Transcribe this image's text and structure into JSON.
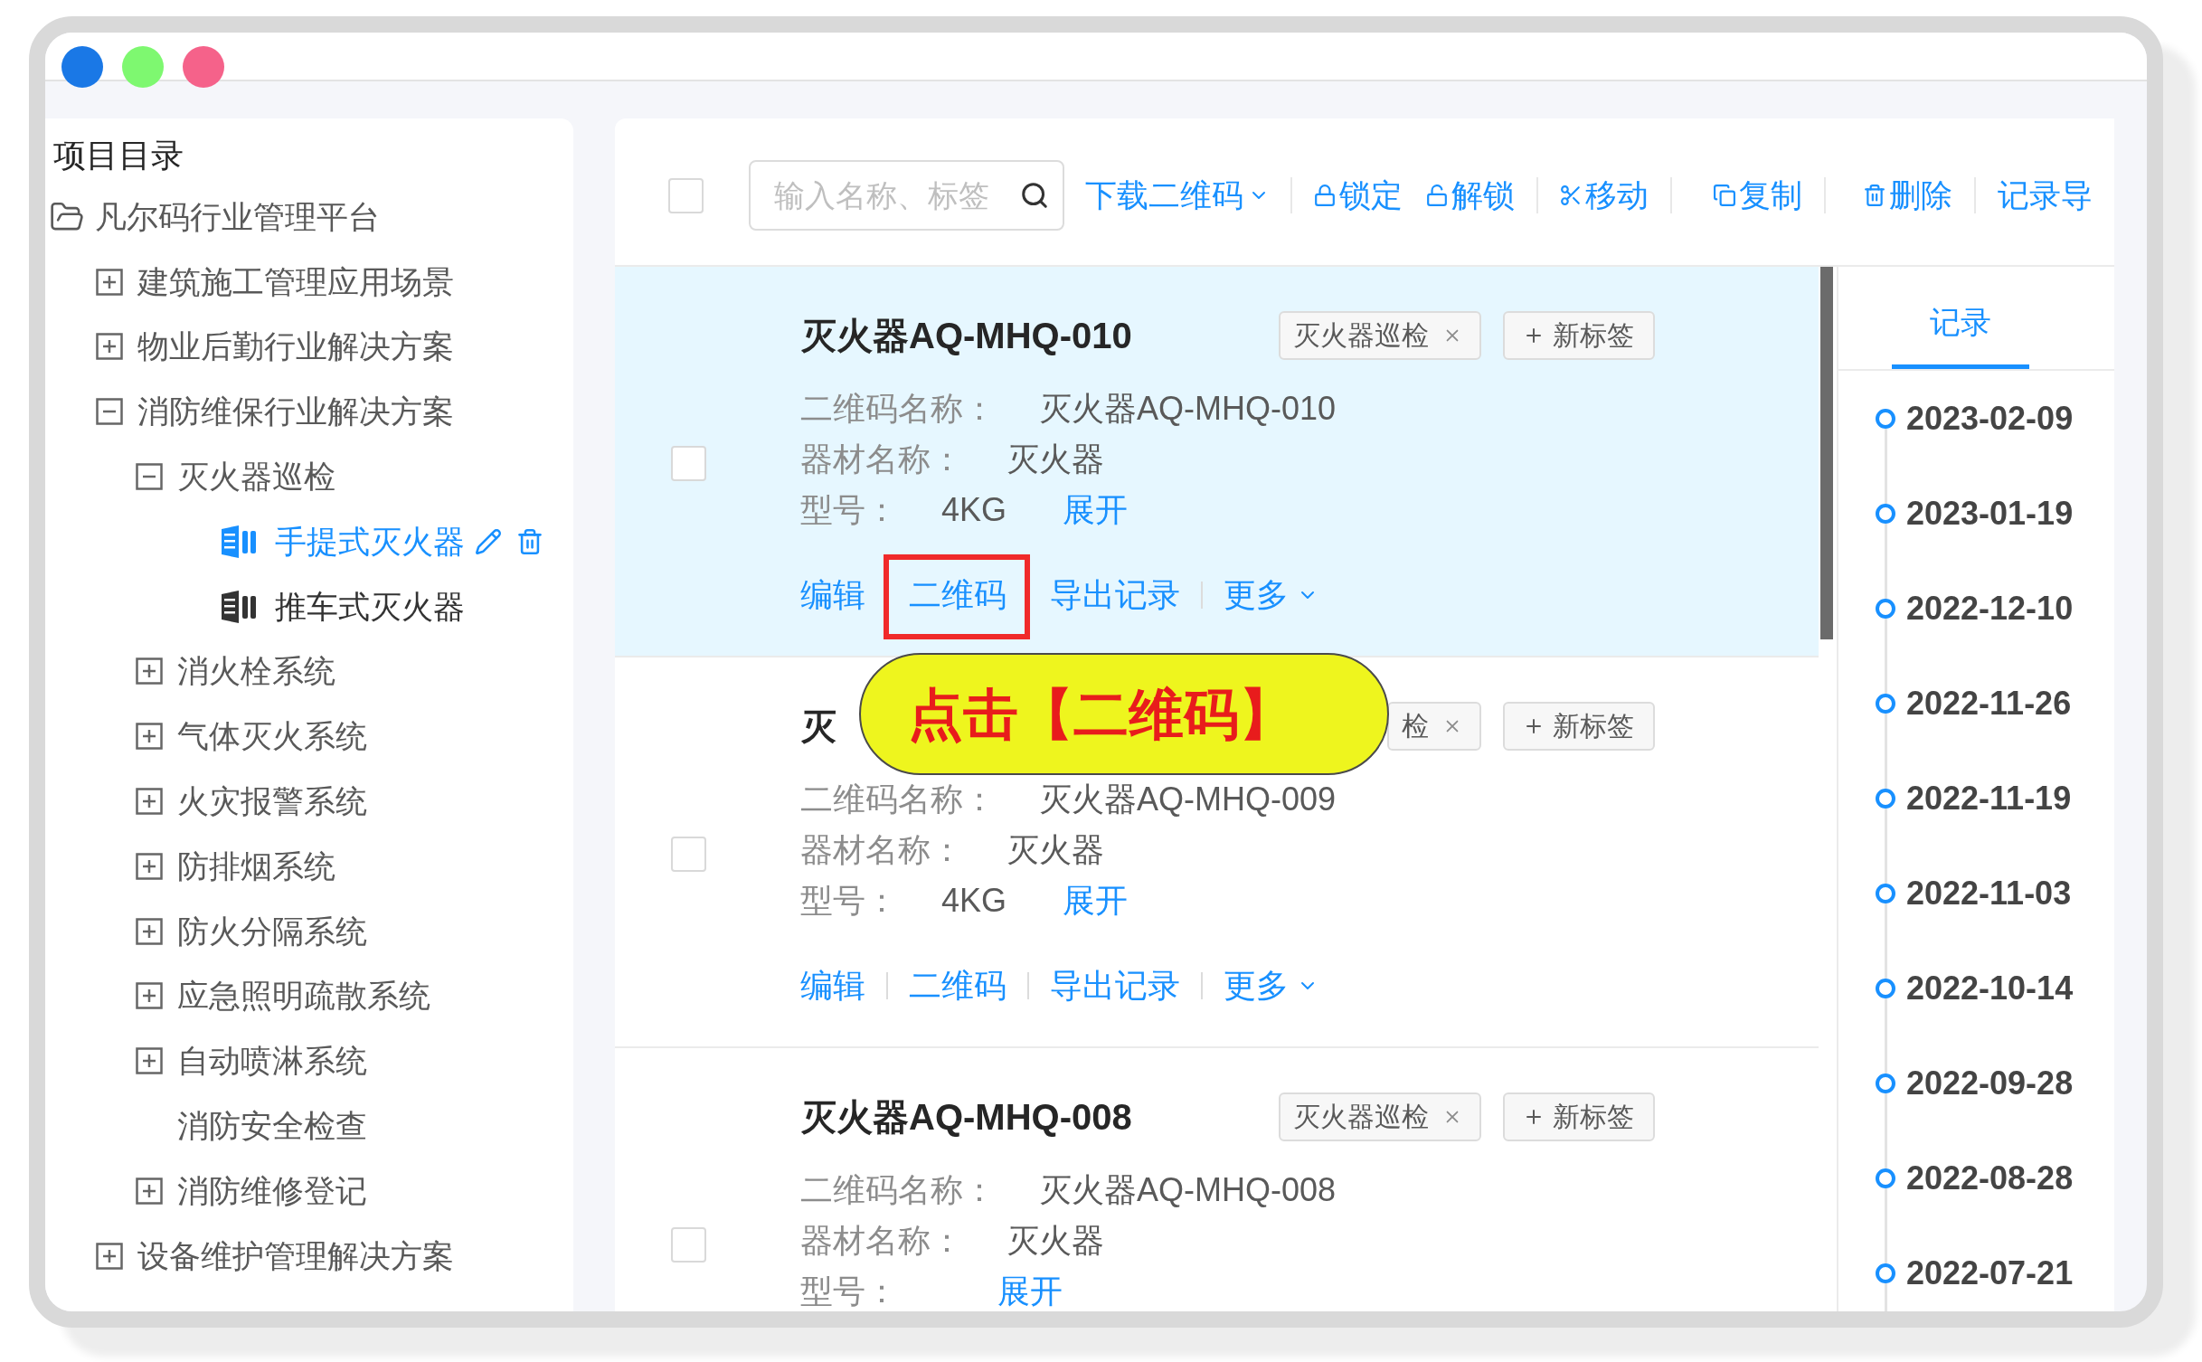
{
  "window": {
    "controls": [
      {
        "color": "#1a78e6"
      },
      {
        "color": "#7ef870"
      },
      {
        "color": "#f5628a"
      }
    ]
  },
  "sidebar": {
    "title": "项目目录",
    "tree": [
      {
        "kind": "root",
        "label": "凡尔码行业管理平台",
        "children": [
          {
            "kind": "group",
            "label": "建筑施工管理应用场景",
            "expanded": false
          },
          {
            "kind": "group",
            "label": "物业后勤行业解决方案",
            "expanded": false
          },
          {
            "kind": "group",
            "label": "消防维保行业解决方案",
            "expanded": true,
            "children": [
              {
                "kind": "group",
                "label": "灭火器巡检",
                "expanded": true,
                "children": [
                  {
                    "kind": "item",
                    "label": "手提式灭火器",
                    "selected": true
                  },
                  {
                    "kind": "item",
                    "label": "推车式灭火器",
                    "selected": false
                  }
                ]
              },
              {
                "kind": "group",
                "label": "消火栓系统",
                "expanded": false
              },
              {
                "kind": "group",
                "label": "气体灭火系统",
                "expanded": false
              },
              {
                "kind": "group",
                "label": "火灾报警系统",
                "expanded": false
              },
              {
                "kind": "group",
                "label": "防排烟系统",
                "expanded": false
              },
              {
                "kind": "group",
                "label": "防火分隔系统",
                "expanded": false
              },
              {
                "kind": "group",
                "label": "应急照明疏散系统",
                "expanded": false
              },
              {
                "kind": "group",
                "label": "自动喷淋系统",
                "expanded": false
              },
              {
                "kind": "leaf",
                "label": "消防安全检查"
              },
              {
                "kind": "group",
                "label": "消防维修登记",
                "expanded": false
              }
            ]
          },
          {
            "kind": "group",
            "label": "设备维护管理解决方案",
            "expanded": false
          }
        ]
      }
    ]
  },
  "toolbar": {
    "select_all": {
      "checked": false
    },
    "search": {
      "placeholder": "输入名称、标签"
    },
    "groups": [
      [
        {
          "kind": "download",
          "label": "下载二维码"
        }
      ],
      [
        {
          "kind": "lock",
          "label": "锁定"
        },
        {
          "kind": "unlock",
          "label": "解锁"
        }
      ],
      [
        {
          "kind": "move",
          "label": "移动"
        }
      ],
      [
        {
          "kind": "copy",
          "label": "复制"
        }
      ],
      [
        {
          "kind": "delete",
          "label": "删除"
        }
      ],
      [
        {
          "kind": "export",
          "label": "记录导"
        }
      ]
    ]
  },
  "cards": [
    {
      "selected": true,
      "checked": false,
      "title": "灭火器AQ-MHQ-010",
      "tags": [
        {
          "kind": "tag",
          "label": "灭火器巡检"
        },
        {
          "kind": "add",
          "label": "新标签"
        }
      ],
      "fields": [
        {
          "label": "二维码名称：",
          "value": "灭火器AQ-MHQ-010"
        },
        {
          "label": "器材名称：",
          "value": "灭火器"
        },
        {
          "label": "型号：",
          "value": "4KG",
          "link": "展开"
        }
      ],
      "actions": [
        {
          "kind": "link",
          "label": "编辑",
          "highlighted": false
        },
        {
          "kind": "link",
          "label": "二维码",
          "highlighted": true
        },
        {
          "kind": "link",
          "label": "导出记录",
          "highlighted": false
        },
        {
          "kind": "menu",
          "label": "更多",
          "highlighted": false
        }
      ]
    },
    {
      "selected": false,
      "checked": false,
      "title": "灭",
      "tags": [
        {
          "kind": "tag",
          "label": "检"
        },
        {
          "kind": "add",
          "label": "新标签"
        }
      ],
      "fields": [
        {
          "label": "二维码名称：",
          "value": "灭火器AQ-MHQ-009"
        },
        {
          "label": "器材名称：",
          "value": "灭火器"
        },
        {
          "label": "型号：",
          "value": "4KG",
          "link": "展开"
        }
      ],
      "actions": [
        {
          "kind": "link",
          "label": "编辑",
          "highlighted": false
        },
        {
          "kind": "link",
          "label": "二维码",
          "highlighted": false
        },
        {
          "kind": "link",
          "label": "导出记录",
          "highlighted": false
        },
        {
          "kind": "menu",
          "label": "更多",
          "highlighted": false
        }
      ]
    },
    {
      "selected": false,
      "checked": false,
      "title": "灭火器AQ-MHQ-008",
      "tags": [
        {
          "kind": "tag",
          "label": "灭火器巡检"
        },
        {
          "kind": "add",
          "label": "新标签"
        }
      ],
      "fields": [
        {
          "label": "二维码名称：",
          "value": "灭火器AQ-MHQ-008"
        },
        {
          "label": "器材名称：",
          "value": "灭火器"
        },
        {
          "label": "型号：",
          "link": "展开"
        }
      ]
    }
  ],
  "records": {
    "tabs": [
      {
        "label": "记录",
        "selected": true
      }
    ],
    "timeline": [
      "2023-02-09",
      "2023-01-19",
      "2022-12-10",
      "2022-11-26",
      "2022-11-19",
      "2022-11-03",
      "2022-10-14",
      "2022-09-28",
      "2022-08-28",
      "2022-07-21"
    ]
  },
  "callout": {
    "text": "点击【二维码】"
  }
}
